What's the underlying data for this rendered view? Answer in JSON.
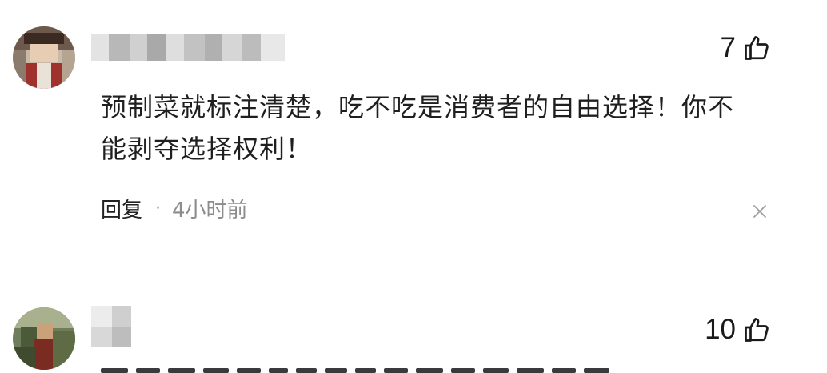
{
  "comments": [
    {
      "like_count": "7",
      "text_line1": "预制菜就标注清楚，吃不吃是消费者的自由选择！你不",
      "text_line2": "能剥夺选择权利！",
      "reply_label": "回复",
      "separator": "·",
      "time": "4小时前"
    },
    {
      "like_count": "10"
    }
  ],
  "icons": {
    "like": "thumbs-up-icon",
    "close": "close-icon"
  },
  "colors": {
    "text": "#1f1f1f",
    "muted": "#8c8c8c",
    "background": "#ffffff"
  }
}
